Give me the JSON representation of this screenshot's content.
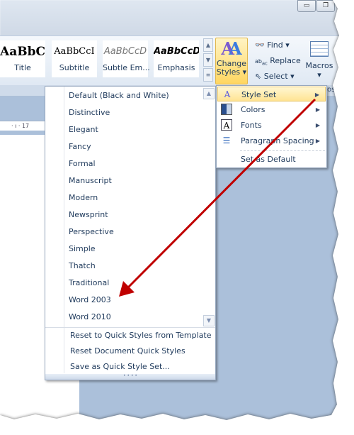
{
  "window": {
    "minimize_icon": "minimize-icon",
    "restore_icon": "restore-icon"
  },
  "ribbon": {
    "styles": [
      {
        "preview": "AaBbC",
        "label": "Title"
      },
      {
        "preview": "AaBbCcI",
        "label": "Subtitle"
      },
      {
        "preview": "AaBbCcD",
        "label": "Subtle Em..."
      },
      {
        "preview": "AaBbCcD",
        "label": "Emphasis"
      }
    ],
    "change_styles": {
      "line1": "Change",
      "line2": "Styles"
    },
    "editing": {
      "find": "Find",
      "replace": "Replace",
      "select": "Select"
    },
    "macros": "Macros",
    "macros_group_label": "os"
  },
  "ruler": {
    "text": "· ı · 17"
  },
  "style_set_menu": {
    "items": [
      "Default (Black and White)",
      "Distinctive",
      "Elegant",
      "Fancy",
      "Formal",
      "Manuscript",
      "Modern",
      "Newsprint",
      "Perspective",
      "Simple",
      "Thatch",
      "Traditional",
      "Word 2003",
      "Word 2010"
    ],
    "actions": [
      "Reset to Quick Styles from Template",
      "Reset Document Quick Styles",
      "Save as Quick Style Set..."
    ]
  },
  "change_styles_menu": {
    "items": [
      {
        "label": "Style Set",
        "icon": "style-set-icon",
        "submenu": true,
        "highlighted": true
      },
      {
        "label": "Colors",
        "icon": "colors-icon",
        "submenu": true
      },
      {
        "label": "Fonts",
        "icon": "fonts-icon",
        "submenu": true
      },
      {
        "label": "Paragraph Spacing",
        "icon": "paragraph-spacing-icon",
        "submenu": true
      },
      {
        "label": "Set as Default"
      }
    ]
  },
  "annotation": {
    "arrow_color": "#c00000"
  },
  "colors": {
    "accent_highlight": "#ffd661",
    "doc_background": "#abc0da",
    "text": "#1e395b"
  }
}
